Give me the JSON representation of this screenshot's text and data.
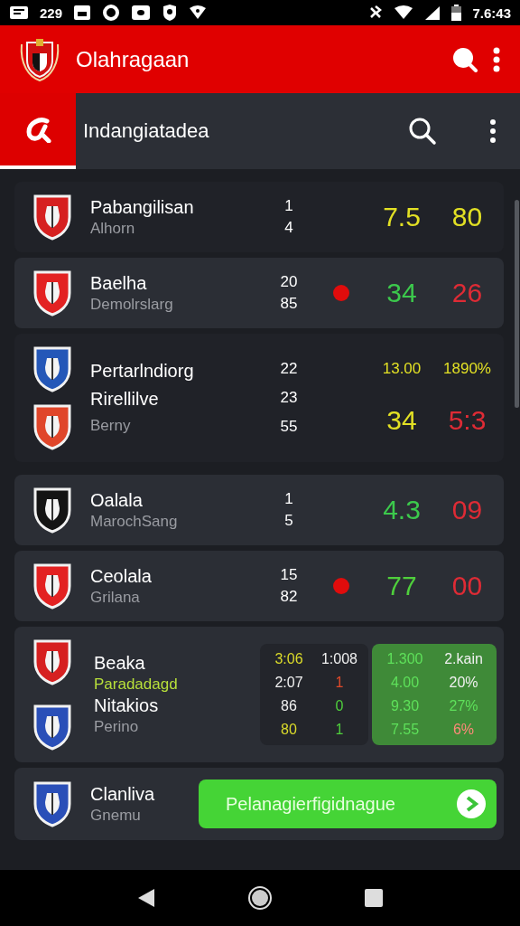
{
  "status_bar": {
    "left_text": "229",
    "time": "7.6:43"
  },
  "app_bar": {
    "title": "Olahragaan"
  },
  "tab_bar": {
    "title": "Indangiatadea"
  },
  "matches": [
    {
      "kind": "single",
      "highlighted": false,
      "live": false,
      "crests": [
        {
          "color": "#d62020"
        }
      ],
      "name": "Pabangilisan",
      "subtitle": "Alhorn",
      "numbers": [
        "1",
        "4"
      ],
      "scores": [
        {
          "text": "7.5",
          "color": "#e2e024"
        },
        {
          "text": "80",
          "color": "#e2e024"
        }
      ]
    },
    {
      "kind": "single",
      "highlighted": true,
      "live": true,
      "crests": [
        {
          "color": "#e32222"
        }
      ],
      "name": "Baelha",
      "subtitle": "Demolrslarg",
      "numbers": [
        "20",
        "85"
      ],
      "scores": [
        {
          "text": "34",
          "color": "#3cc94c"
        },
        {
          "text": "26",
          "color": "#de2b35"
        }
      ]
    },
    {
      "kind": "double",
      "highlighted": false,
      "crests": [
        {
          "color": "#2457b8"
        },
        {
          "color": "#e0462a"
        }
      ],
      "lines": [
        "Pertarlndiorg",
        "Rirellilve",
        "Berny"
      ],
      "numbers": [
        "22",
        "23",
        "55"
      ],
      "small_scores": [
        {
          "text": "13.00",
          "color": "#e2e024"
        },
        {
          "text": "1890%",
          "color": "#e2e024"
        }
      ],
      "scores": [
        {
          "text": "34",
          "color": "#e2e024"
        },
        {
          "text": "5:3",
          "color": "#de2b35"
        }
      ]
    },
    {
      "kind": "single",
      "highlighted": true,
      "live": false,
      "crests": [
        {
          "color": "#141414"
        }
      ],
      "name": "Oalala",
      "subtitle": "MarochSang",
      "numbers": [
        "1",
        "5"
      ],
      "scores": [
        {
          "text": "4.3",
          "color": "#3cc94c"
        },
        {
          "text": "09",
          "color": "#de2b35"
        }
      ]
    },
    {
      "kind": "single",
      "highlighted": true,
      "live": true,
      "crests": [
        {
          "color": "#e32222"
        }
      ],
      "name": "Ceolala",
      "subtitle": "Grilana",
      "numbers": [
        "15",
        "82"
      ],
      "scores": [
        {
          "text": "77",
          "color": "#4fcf3c"
        },
        {
          "text": "00",
          "color": "#de2b35"
        }
      ]
    },
    {
      "kind": "odds",
      "highlighted": true,
      "teams": [
        {
          "name": "Beaka",
          "subtitle": "Paradadagd",
          "crest": {
            "color": "#d62020"
          }
        },
        {
          "name": "Nitakios",
          "subtitle": "Perino",
          "crest": {
            "color": "#2a4fb8"
          }
        }
      ],
      "table": [
        [
          {
            "text": "3:06",
            "color": "#dada2a"
          },
          {
            "text": "1:008",
            "color": "#f0f0f0"
          }
        ],
        [
          {
            "text": "2:07",
            "color": "#f0f0f0"
          },
          {
            "text": "1",
            "color": "#e04a2a"
          }
        ],
        [
          {
            "text": "86",
            "color": "#f0f0f0"
          },
          {
            "text": "0",
            "color": "#4fcf3c"
          }
        ],
        [
          {
            "text": "80",
            "color": "#dada2a"
          },
          {
            "text": "1",
            "color": "#4fcf3c"
          }
        ]
      ],
      "odds": [
        [
          {
            "text": "1.300",
            "color": "#5ee05a"
          },
          {
            "text": "2.kain",
            "color": "#f0f0f0"
          }
        ],
        [
          {
            "text": "4.00",
            "color": "#5ee05a"
          },
          {
            "text": "20%",
            "color": "#f0f0f0"
          }
        ],
        [
          {
            "text": "9.30",
            "color": "#5ee05a"
          },
          {
            "text": "27%",
            "color": "#5ee05a"
          }
        ],
        [
          {
            "text": "7.55",
            "color": "#5ee05a"
          },
          {
            "text": "6%",
            "color": "#ff8a7a"
          }
        ]
      ]
    },
    {
      "kind": "action",
      "highlighted": true,
      "crests": [
        {
          "color": "#2a4fb8"
        }
      ],
      "name": "Clanliva",
      "subtitle": "Gnemu",
      "button": "Pelanagierfigidnague"
    }
  ]
}
